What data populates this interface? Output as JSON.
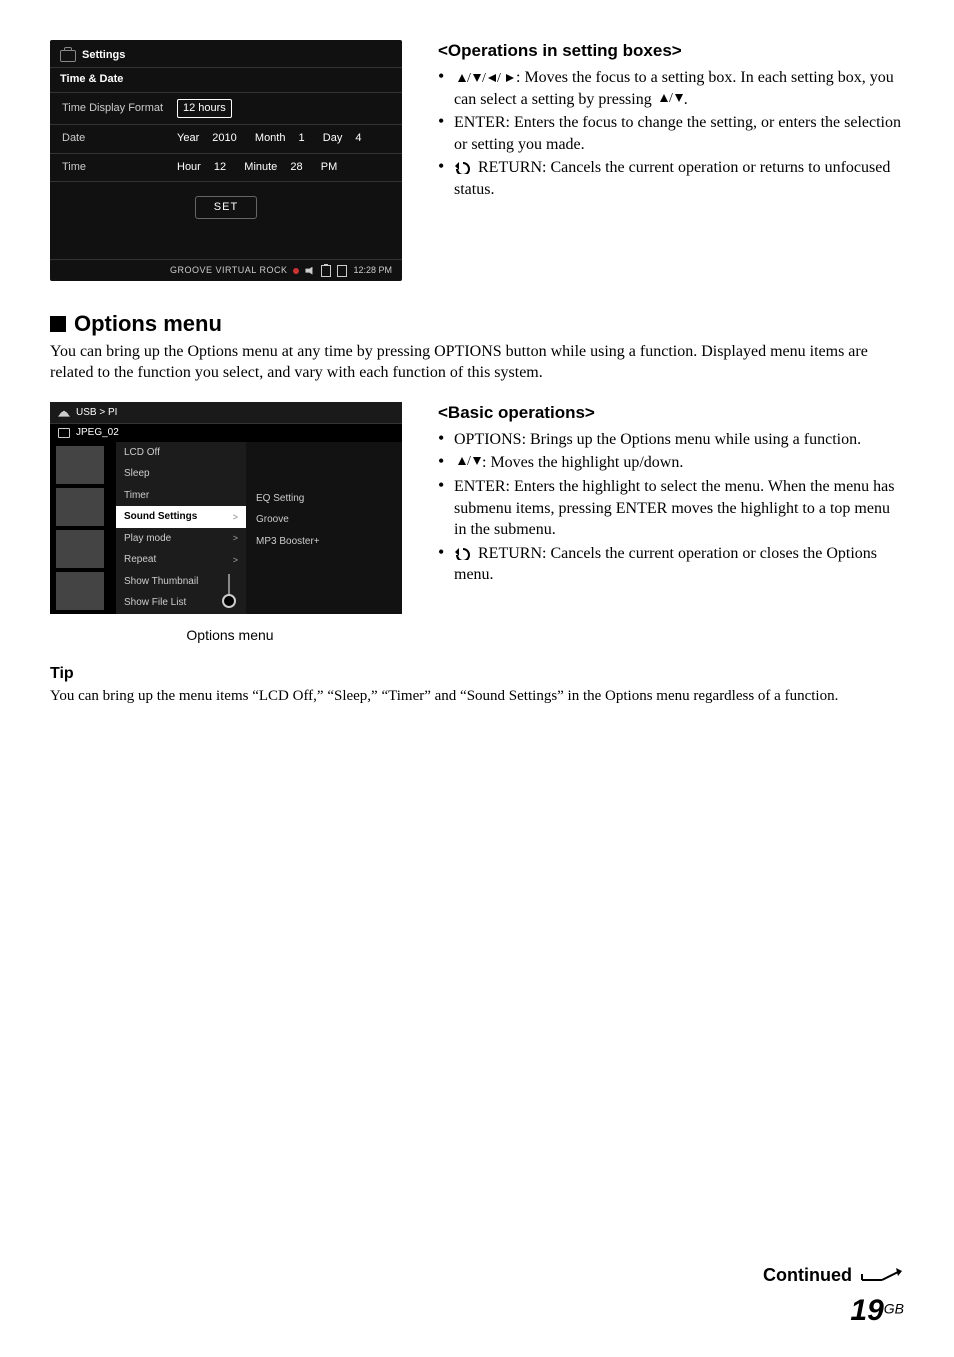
{
  "settings_shot": {
    "title": "Settings",
    "subtitle": "Time & Date",
    "rows": {
      "format_label": "Time Display Format",
      "format_value": "12 hours",
      "date_label": "Date",
      "date_year_l": "Year",
      "date_year_v": "2010",
      "date_month_l": "Month",
      "date_month_v": "1",
      "date_day_l": "Day",
      "date_day_v": "4",
      "time_label": "Time",
      "time_hour_l": "Hour",
      "time_hour_v": "12",
      "time_min_l": "Minute",
      "time_min_v": "28",
      "time_ampm": "PM"
    },
    "set_btn": "SET",
    "status_text": "GROOVE  VIRTUAL  ROCK",
    "status_clock": "12:28 PM"
  },
  "ops_box": {
    "heading": "<Operations in setting boxes>",
    "b1_tail": ": Moves the focus to a setting box. In each setting box, you can select a setting by pressing ",
    "b1_tail2": ".",
    "b2": "ENTER: Enters the focus to change the setting, or enters the selection or setting you made.",
    "b3": " RETURN: Cancels the current operation or returns to unfocused status."
  },
  "options_section": {
    "heading": "Options menu",
    "body": "You can bring up the Options menu at any time by pressing OPTIONS button while using a function. Displayed menu items are related to the function you select, and vary with each function of this system."
  },
  "options_shot": {
    "crumb1": "USB > PI",
    "crumb2": "JPEG_02",
    "menu": [
      "LCD Off",
      "Sleep",
      "Timer",
      "Sound Settings",
      "Play mode",
      "Repeat",
      "Show Thumbnail",
      "Show File List"
    ],
    "highlight_index": 3,
    "submenu": [
      "EQ Setting",
      "Groove",
      "MP3 Booster+"
    ],
    "caption": "Options menu"
  },
  "basic_ops": {
    "heading": "<Basic operations>",
    "b1": "OPTIONS: Brings up the Options menu while using a function.",
    "b2_tail": ": Moves the highlight up/down.",
    "b3": "ENTER: Enters the highlight to select the menu. When the menu has submenu items, pressing ENTER moves the highlight to a top menu in the submenu.",
    "b4": " RETURN: Cancels the current operation or closes the Options menu."
  },
  "tip": {
    "label": "Tip",
    "body": "You can bring up the menu items “LCD Off,” “Sleep,” “Timer” and “Sound Settings” in the Options menu regardless of a function."
  },
  "continued": "Continued",
  "page_num": "19",
  "page_suffix": "GB"
}
